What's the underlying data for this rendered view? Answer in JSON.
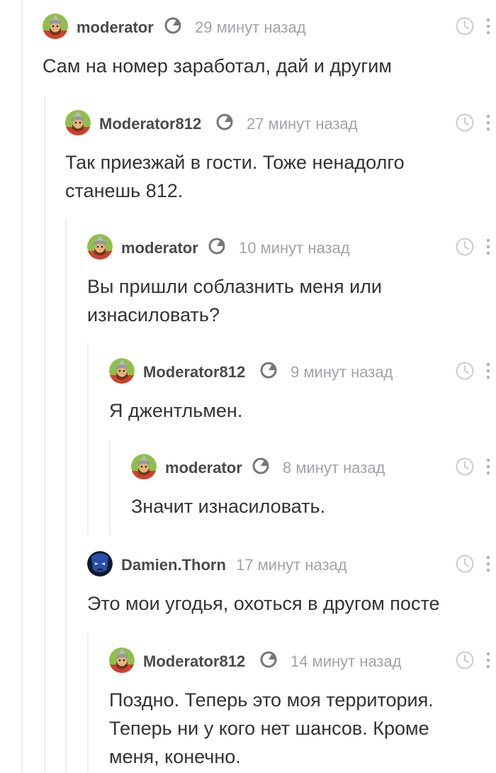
{
  "comments": [
    {
      "author": "moderator",
      "time": "29 минут назад",
      "text": "Сам на номер заработал, дай и другим"
    },
    {
      "author": "Moderator812",
      "time": "27 минут назад",
      "text": "Так приезжай в гости. Тоже ненадолго станешь 812."
    },
    {
      "author": "moderator",
      "time": "10 минут назад",
      "text": "Вы пришли соблазнить меня или изнасиловать?"
    },
    {
      "author": "Moderator812",
      "time": "9 минут назад",
      "text": "Я джентльмен."
    },
    {
      "author": "moderator",
      "time": "8 минут назад",
      "text": "Значит изнасиловать."
    },
    {
      "author": "Damien.Thorn",
      "time": "17 минут назад",
      "text": "Это мои угодья, охоться в другом посте"
    },
    {
      "author": "Moderator812",
      "time": "14 минут назад",
      "text": "Поздно. Теперь это моя территория. Теперь ни у кого нет шансов. Кроме меня, конечно."
    }
  ],
  "icons": {
    "moderator_badge": "moderator-badge-icon",
    "clock": "clock-icon",
    "more": "more-vertical-icon"
  },
  "colors": {
    "author": "#4a4a4a",
    "time": "#a0a4a8",
    "text": "#333333",
    "rail": "#eeeeee"
  }
}
